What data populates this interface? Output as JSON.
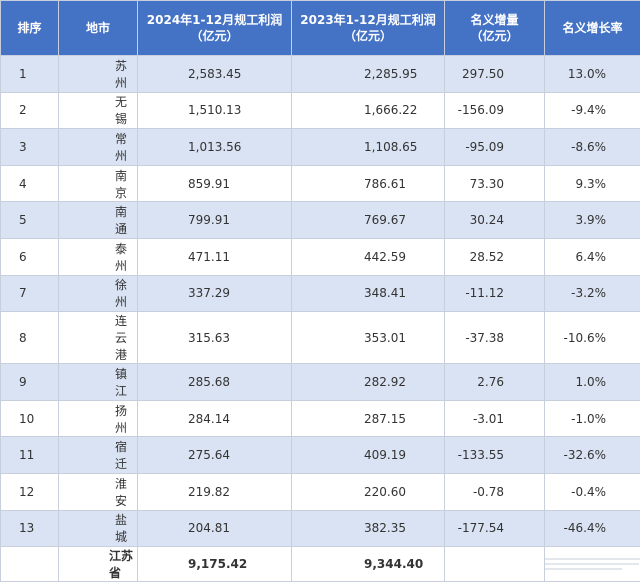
{
  "headers": {
    "rank": "排序",
    "city": "地市",
    "profit_2024": [
      "2024年1-12月规工利润",
      "（亿元）"
    ],
    "profit_2023": [
      "2023年1-12月规工利润",
      "（亿元）"
    ],
    "increase": [
      "名义增量",
      "（亿元）"
    ],
    "growth": "名义增长率"
  },
  "rows": [
    {
      "rank": "1",
      "city": "苏州",
      "p2024": "2,583.45",
      "p2023": "2,285.95",
      "inc": "297.50",
      "rate": "13.0%"
    },
    {
      "rank": "2",
      "city": "无锡",
      "p2024": "1,510.13",
      "p2023": "1,666.22",
      "inc": "-156.09",
      "rate": "-9.4%"
    },
    {
      "rank": "3",
      "city": "常州",
      "p2024": "1,013.56",
      "p2023": "1,108.65",
      "inc": "-95.09",
      "rate": "-8.6%"
    },
    {
      "rank": "4",
      "city": "南京",
      "p2024": "859.91",
      "p2023": "786.61",
      "inc": "73.30",
      "rate": "9.3%"
    },
    {
      "rank": "5",
      "city": "南通",
      "p2024": "799.91",
      "p2023": "769.67",
      "inc": "30.24",
      "rate": "3.9%"
    },
    {
      "rank": "6",
      "city": "泰州",
      "p2024": "471.11",
      "p2023": "442.59",
      "inc": "28.52",
      "rate": "6.4%"
    },
    {
      "rank": "7",
      "city": "徐州",
      "p2024": "337.29",
      "p2023": "348.41",
      "inc": "-11.12",
      "rate": "-3.2%"
    },
    {
      "rank": "8",
      "city": "连云港",
      "p2024": "315.63",
      "p2023": "353.01",
      "inc": "-37.38",
      "rate": "-10.6%"
    },
    {
      "rank": "9",
      "city": "镇江",
      "p2024": "285.68",
      "p2023": "282.92",
      "inc": "2.76",
      "rate": "1.0%"
    },
    {
      "rank": "10",
      "city": "扬州",
      "p2024": "284.14",
      "p2023": "287.15",
      "inc": "-3.01",
      "rate": "-1.0%"
    },
    {
      "rank": "11",
      "city": "宿迁",
      "p2024": "275.64",
      "p2023": "409.19",
      "inc": "-133.55",
      "rate": "-32.6%"
    },
    {
      "rank": "12",
      "city": "淮安",
      "p2024": "219.82",
      "p2023": "220.60",
      "inc": "-0.78",
      "rate": "-0.4%"
    },
    {
      "rank": "13",
      "city": "盐城",
      "p2024": "204.81",
      "p2023": "382.35",
      "inc": "-177.54",
      "rate": "-46.4%"
    }
  ],
  "total": {
    "city": "江苏省",
    "p2024": "9,175.42",
    "p2023": "9,344.40"
  },
  "colors": {
    "header_bg": "#4472c4",
    "band_bg": "#dae3f3",
    "border": "#c8cfdc"
  }
}
